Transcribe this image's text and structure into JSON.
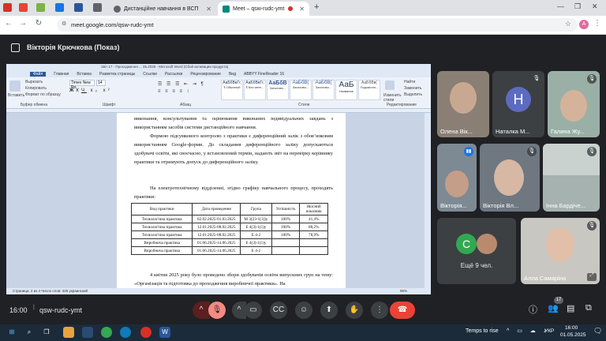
{
  "browser": {
    "tabs": [
      {
        "label": "Дистанційне навчання в ВСП",
        "active": false
      },
      {
        "label": "Meet – qsw-rudc-ymt",
        "active": true
      }
    ],
    "new_tab_label": "+",
    "url": "meet.google.com/qsw-rudc-ymt"
  },
  "meet": {
    "presenter_label": "Вікторія Крючкова (Показ)",
    "time": "16:00",
    "meeting_code": "qsw-rudc-ymt",
    "people_count": "17",
    "more_people": "Ещё 9 чел.",
    "participants": [
      {
        "name": "Олена Вік...",
        "mic_off": false
      },
      {
        "name": "Наталка М...",
        "initial": "Н",
        "mic_off": true
      },
      {
        "name": "Галина Жу...",
        "mic_off": true
      },
      {
        "name": "Вікторія...",
        "mic_off": false
      },
      {
        "name": "Вікторія Вл...",
        "mic_off": true
      },
      {
        "name": "Інна Бардіче...",
        "mic_off": true
      },
      {
        "name": "Алла Самаріна",
        "mic_off": true
      }
    ],
    "more_initial": "С"
  },
  "word": {
    "title_bar": "Звіт 17 - Проходження ... 05.2025 - Microsoft Word (Сбой активации продукта)",
    "ribbon_tabs": [
      "Файл",
      "Главная",
      "Вставка",
      "Разметка страницы",
      "Ссылки",
      "Рассылки",
      "Рецензирование",
      "Вид",
      "ABBYY FineReader 16"
    ],
    "font_name": "Times New Ro",
    "font_size": "14",
    "group_labels": [
      "Буфер обмена",
      "Шрифт",
      "Абзац",
      "Стили",
      "Редактирование"
    ],
    "clipboard": {
      "paste": "Вставить",
      "cut": "Вырезать",
      "copy": "Копировать",
      "format": "Формат по образцу"
    },
    "styles": [
      {
        "sample": "АаБбВвГг,",
        "name": "¶ Обычный"
      },
      {
        "sample": "АаБбВвГг,",
        "name": "¶ Без инте..."
      },
      {
        "sample": "АаБбВ",
        "name": "Заголово..."
      },
      {
        "sample": "АаБбВ(",
        "name": "Заголово..."
      },
      {
        "sample": "АаБбВ(",
        "name": "Заголово..."
      },
      {
        "sample": "АаБ",
        "name": "Название"
      },
      {
        "sample": "АаБбВв(",
        "name": "Подзаголо..."
      }
    ],
    "change_styles": "Изменить стили",
    "editing": {
      "find": "Найти",
      "replace": "Заменить",
      "select": "Выделить"
    },
    "paragraphs": [
      "виконання, консультування та оцінювання виконаних індивідуальних завдань з використанням засобів системи дистанційного навчання.",
      "Формою підсумкового контролю з практики є диференційний залік з обов’язковим використанням Google-форми. До складання диференційного заліку допускаються здобувачі освіти, які своєчасно, у встановлений термін, надають звіт на перевірку керівнику практики та отримують допуск до диференційного заліку.",
      "На електротехнічному відділенні, згідно графіку навчального процесу, проходять практики:"
    ],
    "table": {
      "headers": [
        "Вид практики",
        "Дата проведення",
        "Група",
        "Успішність",
        "Якісний показник"
      ],
      "rows": [
        [
          "Технологічна практика",
          "02.02.2025-01.03.2025",
          "М 3(23-1(1))у",
          "100%",
          "41,4%"
        ],
        [
          "Технологічна практика",
          "12.01.2025-08.02.2025",
          "Е 4(3)-1(1)у",
          "100%",
          "88,2%"
        ],
        [
          "Технологічна практика",
          "12.01.2025-08.02.2025",
          "Е 4-2",
          "100%",
          "78,9%"
        ],
        [
          "Виробнича практика",
          "01.06.2025-14.06.2025",
          "Е 4(3)-1(1)у",
          "",
          ""
        ],
        [
          "Виробнича практика",
          "01.06.2025-14.06.2025",
          "Е 4-2",
          "",
          ""
        ]
      ]
    },
    "paragraph_after": "4 квітня 2025 року було проведено збори здобувачів освіти випускних груп на тему: «Організація та підготовка до проходження виробничої практики». На",
    "status": "Страница: 2 из 4   Число слов: 345   украинский",
    "zoom": "95%"
  },
  "taskbar": {
    "weather": "Temps to rise",
    "lang": "УКР",
    "time": "16:00",
    "date": "01.05.2025"
  },
  "colors": {
    "meet_bg": "#202124",
    "hangup": "#ea4335",
    "mic_muted": "#f28b82",
    "word_blue": "#2b579a"
  }
}
